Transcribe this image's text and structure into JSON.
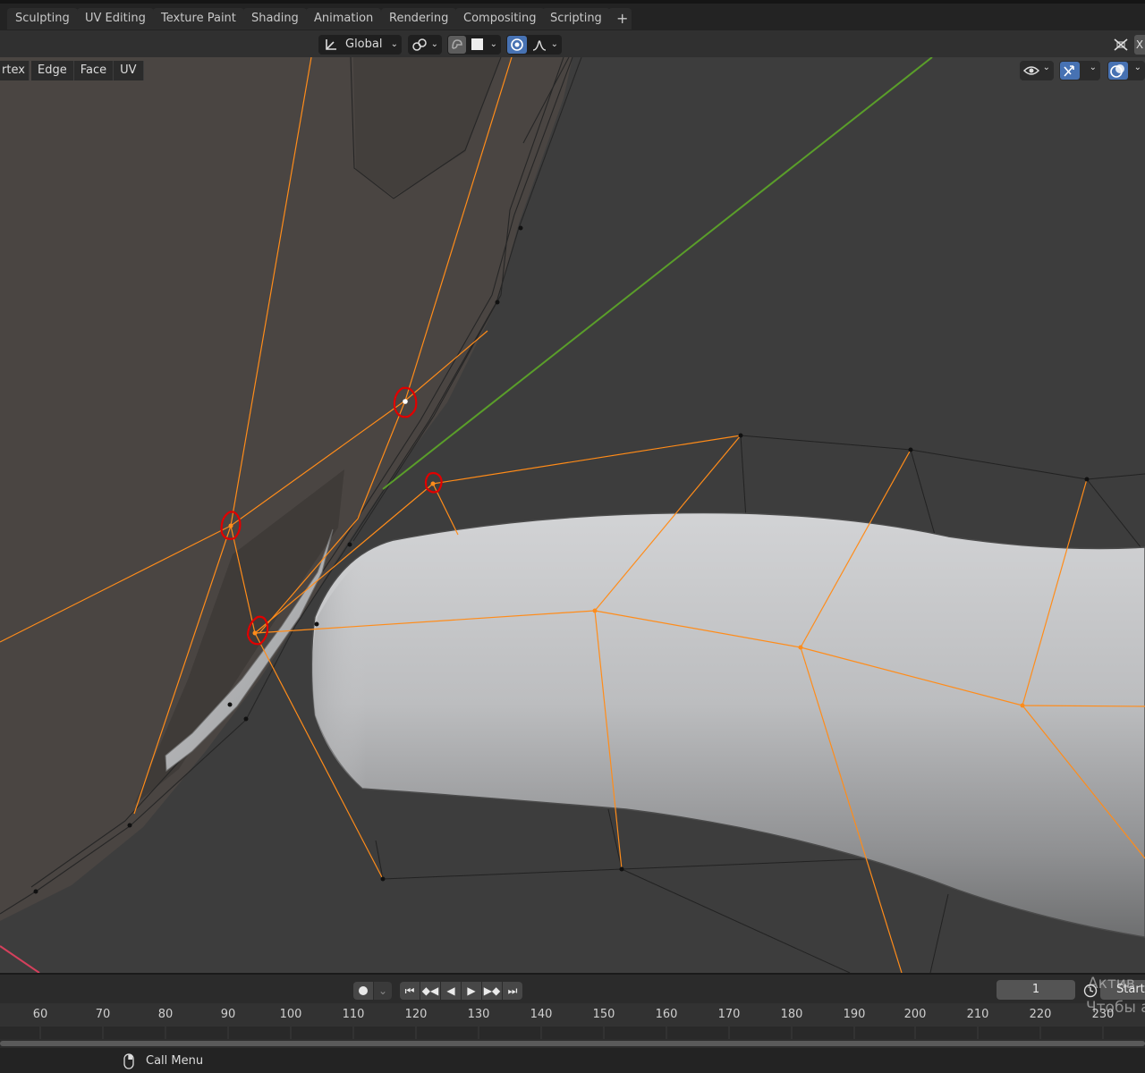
{
  "workspace_tabs": [
    "Sculpting",
    "UV Editing",
    "Texture Paint",
    "Shading",
    "Animation",
    "Rendering",
    "Compositing",
    "Scripting"
  ],
  "add_workspace_label": "+",
  "header": {
    "orientation_label": "Global",
    "xray_label": "X"
  },
  "select_modes": [
    "rtex",
    "Edge",
    "Face",
    "UV"
  ],
  "timeline": {
    "current_frame": "1",
    "start_label": "Start",
    "ruler_ticks": [
      "60",
      "70",
      "80",
      "90",
      "100",
      "110",
      "120",
      "130",
      "140",
      "150",
      "160",
      "170",
      "180",
      "190",
      "200",
      "210",
      "220",
      "230"
    ]
  },
  "watermark": {
    "line1": "Актив",
    "line2": "Чтобы а"
  },
  "status": {
    "call_menu_label": "Call Menu"
  },
  "colors": {
    "accent_blue": "#4772b3",
    "selection_orange": "#ff8c1a",
    "annotation_red": "#e00000",
    "axis_green": "#5a9e2a",
    "axis_red": "#d4405c"
  },
  "icons": [
    "transform-pivot-icon",
    "snap-icon",
    "proportional-editing-icon",
    "falloff-icon",
    "visibility-icon",
    "gizmo-icon",
    "overlay-icon",
    "xray-icon",
    "record-icon",
    "jump-start-icon",
    "prev-keyframe-icon",
    "play-reverse-icon",
    "play-icon",
    "next-keyframe-icon",
    "jump-end-icon",
    "clock-icon",
    "mouse-icon"
  ]
}
